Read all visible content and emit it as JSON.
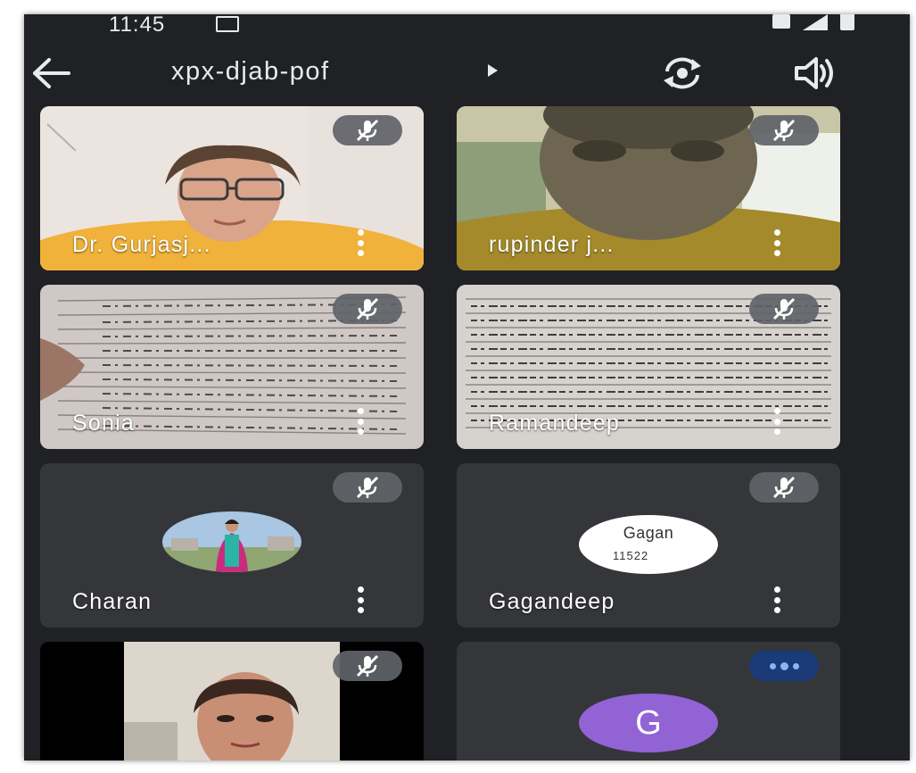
{
  "status_bar": {
    "time": "11:45"
  },
  "meeting": {
    "code": "xpx-djab-pof"
  },
  "participants": [
    {
      "name": "Dr. Gurjasj..."
    },
    {
      "name": "rupinder j..."
    },
    {
      "name": "Sonia"
    },
    {
      "name": "Ramandeep"
    },
    {
      "name": "Charan"
    },
    {
      "name": "Gagandeep",
      "avatar_text": "Gagan",
      "avatar_number": "11522"
    },
    {
      "name": ""
    },
    {
      "name": "",
      "avatar_letter": "G"
    }
  ],
  "colors": {
    "background": "#202124",
    "tile": "#3c4043",
    "speaking_badge": "#1a3a78",
    "letter_avatar": "#9263d4"
  },
  "icons": {
    "back": "arrow-left-icon",
    "play": "play-triangle-icon",
    "switch_camera": "camera-switch-icon",
    "speaker": "speaker-icon",
    "mic_off": "mic-off-icon",
    "more": "more-vertical-icon",
    "speaking": "speaking-dots-icon"
  }
}
